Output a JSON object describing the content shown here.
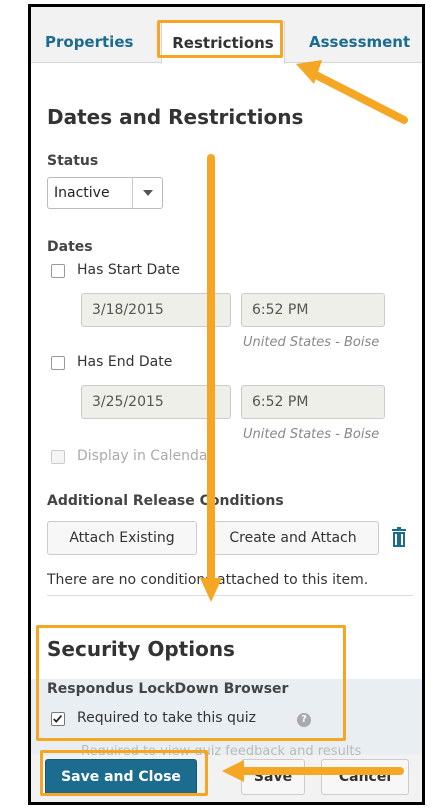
{
  "tabs": {
    "properties": "Properties",
    "restrictions": "Restrictions",
    "assessment": "Assessment"
  },
  "dates_restrictions": {
    "heading": "Dates and Restrictions",
    "status_label": "Status",
    "status_value": "Inactive",
    "dates_label": "Dates",
    "has_start_date": "Has Start Date",
    "start_date": "3/18/2015",
    "start_time": "6:52 PM",
    "timezone": "United States - Boise",
    "has_end_date": "Has End Date",
    "end_date": "3/25/2015",
    "end_time": "6:52 PM",
    "timezone_end": "United States - Boise",
    "display_in_calendar": "Display in Calendar"
  },
  "release_conditions": {
    "label": "Additional Release Conditions",
    "attach_existing": "Attach Existing",
    "create_and_attach": "Create and Attach",
    "empty_note": "There are no conditions attached to this item."
  },
  "security": {
    "heading": "Security Options",
    "lockdown_label": "Respondus LockDown Browser",
    "required_quiz": "Required to take this quiz",
    "required_feedback": "Required to view quiz feedback and results",
    "help_icon": "question-mark-icon"
  },
  "footer": {
    "save_and_close": "Save and Close",
    "save": "Save",
    "cancel": "Cancel"
  },
  "colors": {
    "accent": "#1b6c8e",
    "highlight": "#f5a623",
    "field_bg": "#efefe9"
  }
}
